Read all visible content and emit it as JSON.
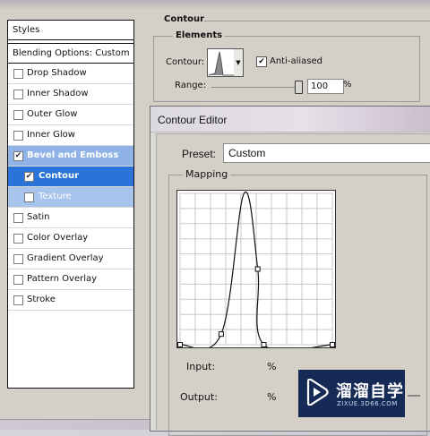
{
  "layer_style": {
    "styles_header": "Styles",
    "blending_options": "Blending Options: Custom",
    "items": [
      {
        "label": "Drop Shadow",
        "checked": false,
        "state": "normal"
      },
      {
        "label": "Inner Shadow",
        "checked": false,
        "state": "normal"
      },
      {
        "label": "Outer Glow",
        "checked": false,
        "state": "normal"
      },
      {
        "label": "Inner Glow",
        "checked": false,
        "state": "normal"
      },
      {
        "label": "Bevel and Emboss",
        "checked": true,
        "state": "highlighted"
      },
      {
        "label": "Contour",
        "checked": true,
        "state": "selected"
      },
      {
        "label": "Texture",
        "checked": false,
        "state": "highlighted-sub"
      },
      {
        "label": "Satin",
        "checked": false,
        "state": "normal"
      },
      {
        "label": "Color Overlay",
        "checked": false,
        "state": "normal"
      },
      {
        "label": "Gradient Overlay",
        "checked": false,
        "state": "normal"
      },
      {
        "label": "Pattern Overlay",
        "checked": false,
        "state": "normal"
      },
      {
        "label": "Stroke",
        "checked": false,
        "state": "normal"
      }
    ]
  },
  "contour_section": {
    "title": "Contour",
    "elements_title": "Elements",
    "contour_label": "Contour:",
    "anti_aliased_label": "Anti-aliased",
    "anti_aliased_checked": true,
    "range_label": "Range:",
    "range_value": "100",
    "range_unit": "%",
    "range_slider_fraction": 1.0
  },
  "contour_editor": {
    "title": "Contour Editor",
    "preset_label": "Preset:",
    "preset_value": "Custom",
    "mapping_title": "Mapping",
    "input_label": "Input:",
    "input_unit": "%",
    "output_label": "Output:",
    "output_unit": "%",
    "curve_points": [
      {
        "input": 0,
        "output": 0
      },
      {
        "input": 27,
        "output": 7
      },
      {
        "input": 42,
        "output": 100
      },
      {
        "input": 51,
        "output": 50
      },
      {
        "input": 55,
        "output": 0
      },
      {
        "input": 100,
        "output": 0
      }
    ]
  },
  "watermark": {
    "text": "溜溜自学",
    "subtext": "ZIXUE.3D66.COM"
  }
}
